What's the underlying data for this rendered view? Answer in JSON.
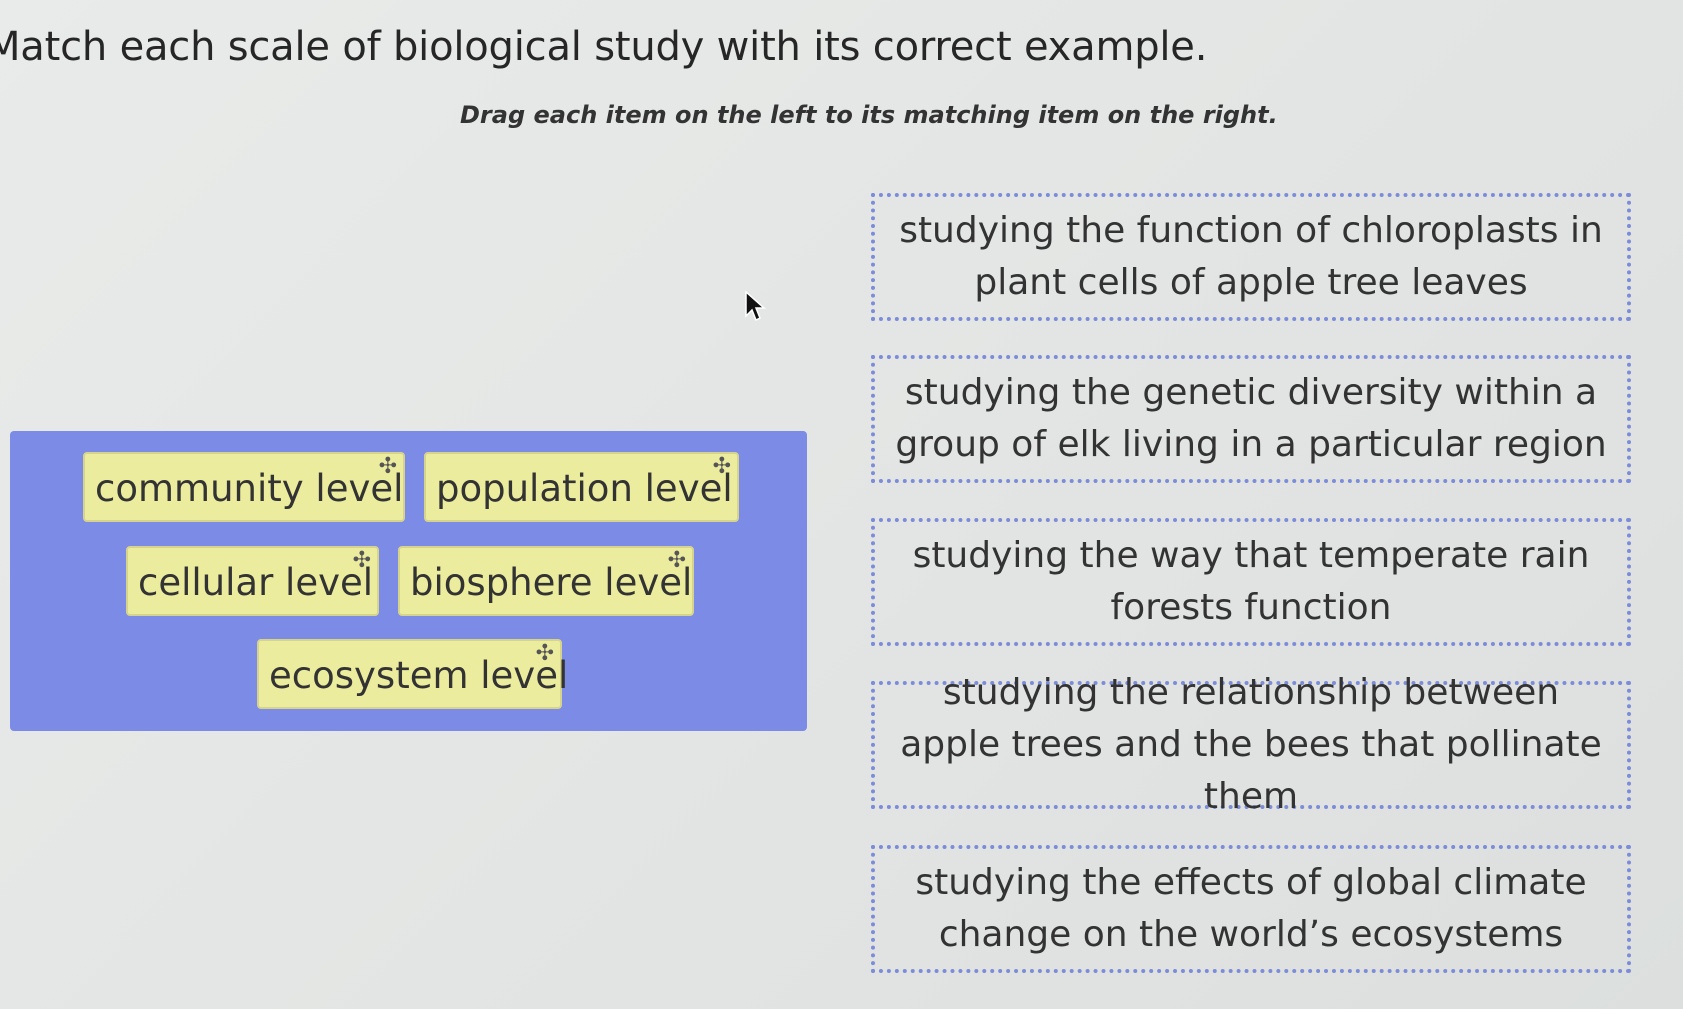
{
  "title": "Match each scale of biological study with its correct example.",
  "instructions": "Drag each item on the left to its matching item on the right.",
  "source_items": [
    {
      "label": "community level"
    },
    {
      "label": "population level"
    },
    {
      "label": "cellular level"
    },
    {
      "label": "biosphere level"
    },
    {
      "label": "ecosystem level"
    }
  ],
  "targets": [
    {
      "text": "studying the function of chloroplasts in plant cells of apple tree leaves"
    },
    {
      "text": "studying the genetic diversity within a group of elk living in a particular region"
    },
    {
      "text": "studying the way that temperate rain forests function"
    },
    {
      "text": "studying the relationship between apple trees and the bees that pollinate them"
    },
    {
      "text": "studying the effects of global climate change on the world’s ecosystems"
    }
  ],
  "drag_handle_glyph": "✣",
  "colors": {
    "bank_background": "#7b8be6",
    "chip_background": "#ecec9e",
    "target_border": "#7d8cd8"
  }
}
